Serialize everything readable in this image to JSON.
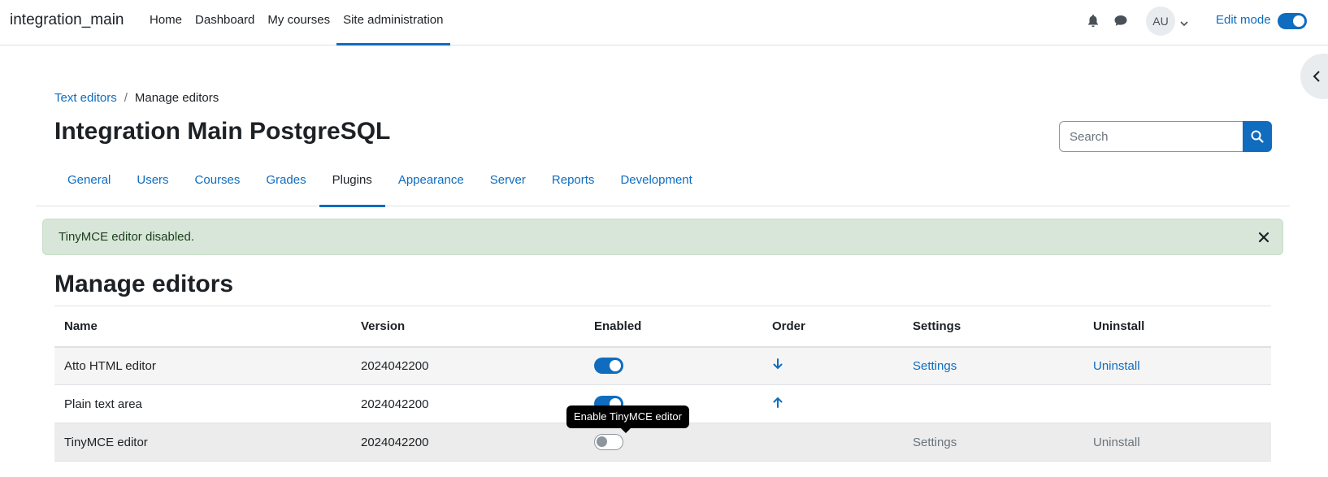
{
  "navbar": {
    "brand": "integration_main",
    "items": [
      {
        "label": "Home"
      },
      {
        "label": "Dashboard"
      },
      {
        "label": "My courses"
      },
      {
        "label": "Site administration",
        "active": true
      }
    ],
    "user_initials": "AU",
    "edit_mode_label": "Edit mode",
    "edit_mode_on": true
  },
  "breadcrumb": {
    "parent": "Text editors",
    "separator": "/",
    "current": "Manage editors"
  },
  "page_title": "Integration Main PostgreSQL",
  "search": {
    "placeholder": "Search"
  },
  "secondary_nav": {
    "tabs": [
      {
        "label": "General"
      },
      {
        "label": "Users"
      },
      {
        "label": "Courses"
      },
      {
        "label": "Grades"
      },
      {
        "label": "Plugins",
        "active": true
      },
      {
        "label": "Appearance"
      },
      {
        "label": "Server"
      },
      {
        "label": "Reports"
      },
      {
        "label": "Development"
      }
    ]
  },
  "alert": {
    "message": "TinyMCE editor disabled."
  },
  "section_title": "Manage editors",
  "table": {
    "headers": {
      "name": "Name",
      "version": "Version",
      "enabled": "Enabled",
      "order": "Order",
      "settings": "Settings",
      "uninstall": "Uninstall"
    },
    "rows": [
      {
        "name": "Atto HTML editor",
        "version": "2024042200",
        "enabled": true,
        "order": "down",
        "settings": "Settings",
        "uninstall": "Uninstall"
      },
      {
        "name": "Plain text area",
        "version": "2024042200",
        "enabled": true,
        "order": "up",
        "settings": "",
        "uninstall": ""
      },
      {
        "name": "TinyMCE editor",
        "version": "2024042200",
        "enabled": false,
        "order": "",
        "settings": "Settings",
        "uninstall": "Uninstall"
      }
    ]
  },
  "tooltip": {
    "text": "Enable TinyMCE editor"
  },
  "colors": {
    "primary": "#0f6cbf",
    "alert_success_bg": "#d7e6d8",
    "text": "#1d2125"
  }
}
